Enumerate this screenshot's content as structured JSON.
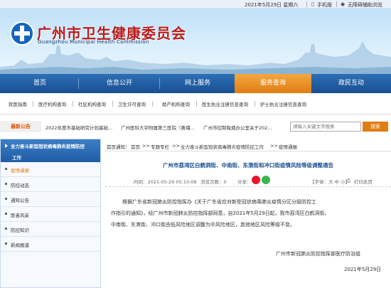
{
  "topbar": {
    "date": "2021年5月29日 星期六",
    "mobile": "手机版",
    "accessible": "无障碍辅助浏览"
  },
  "header": {
    "title": "广州市卫生健康委员会",
    "subtitle": "Guangzhou Municipal Health Commission"
  },
  "nav": {
    "items": [
      "首页",
      "信息公开",
      "网上服务",
      "服务查询",
      "政民互动"
    ],
    "active_index": 3
  },
  "subnav": {
    "items": [
      "就医指南",
      "医疗机构查询",
      "社区机构查询",
      "卫生许可查询",
      "助产机构查询",
      "医生执业注册信息查询",
      "护士执业注册信息查询"
    ]
  },
  "notice": {
    "label": "最新公告",
    "items": [
      "2022年度市基础研究计划基础...",
      "广州医科大学附属第三医院（黄埔...",
      "广州市控制吸烟办公室关于202..."
    ],
    "search_placeholder": "请输入关键文字搜索",
    "search_button": "搜索"
  },
  "sidebar": {
    "heading_line1": "全力奋斗新型冠状病毒肺炎疫情防控",
    "heading_line2": "工作",
    "items": [
      "疫情通报",
      "防控动态",
      "通知公告",
      "医者风采",
      "防控知识",
      "新闻报道"
    ],
    "active_index": 0
  },
  "breadcrumb": {
    "label": "首页通知：",
    "items": [
      "首页",
      "专题专栏",
      "全力奋斗新型冠状病毒肺炎疫情防控工作",
      "疫情通报"
    ],
    "separator": ">>"
  },
  "article": {
    "title": "广州市荔湾区白鹤洞街、中南街、东漖街和冲口街疫情风险等级调整通告",
    "time_label": "时间：2021-05-29 05:10:08",
    "views_label": "浏览次数：0",
    "share_label": "分享：",
    "font_label": "【字体：大 中 小】",
    "print_label": "打印此页",
    "paragraph_lines": [
      "根据广东省新冠肺炎防控指挥办《关于广东省应对新型冠状病毒肺炎疫情分区分级防控工",
      "作指引的通知》，经广州市新冠肺炎防控指挥部同意，自2021年5月29日起，我市荔湾区白鹤洞街、",
      "中南街、东漖街、冲口街由低风险地区调整为中风险地区，其他地区风险等级不变。"
    ],
    "signature": "广州市新冠肺炎防控指挥部医疗防治组",
    "date": "2021年5月29日"
  },
  "colors": {
    "nav_blue": "#1a4f91",
    "nav_active": "#e07d12",
    "title_red": "#b71c1c",
    "wechat_green": "#3bb54a",
    "weibo_red": "#e6162d"
  }
}
